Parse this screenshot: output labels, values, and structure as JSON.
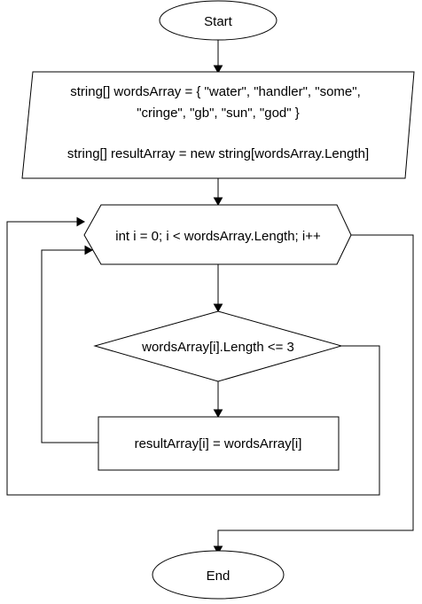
{
  "flowchart": {
    "start": {
      "label": "Start"
    },
    "init": {
      "line1": "string[] wordsArray = { \"water\", \"handler\", \"some\",",
      "line2": "\"cringe\", \"gb\", \"sun\", \"god\" }",
      "line3": "string[] resultArray = new string[wordsArray.Length]"
    },
    "loop": {
      "label": "int i = 0; i < wordsArray.Length; i++"
    },
    "condition": {
      "label": "wordsArray[i].Length <= 3"
    },
    "assign": {
      "label": "resultArray[i] = wordsArray[i]"
    },
    "end": {
      "label": "End"
    }
  }
}
